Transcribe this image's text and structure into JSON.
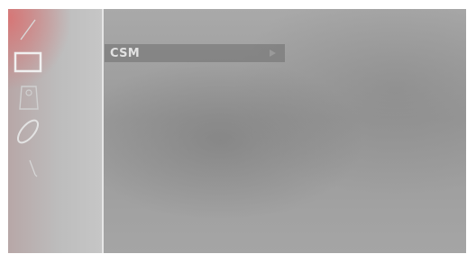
{
  "menu": {
    "items": [
      {
        "label": "CSM",
        "has_submenu": true
      }
    ]
  },
  "sidebar": {
    "icons": [
      "pen-icon",
      "display-icon",
      "storage-icon",
      "disc-icon",
      "tool-icon"
    ]
  }
}
